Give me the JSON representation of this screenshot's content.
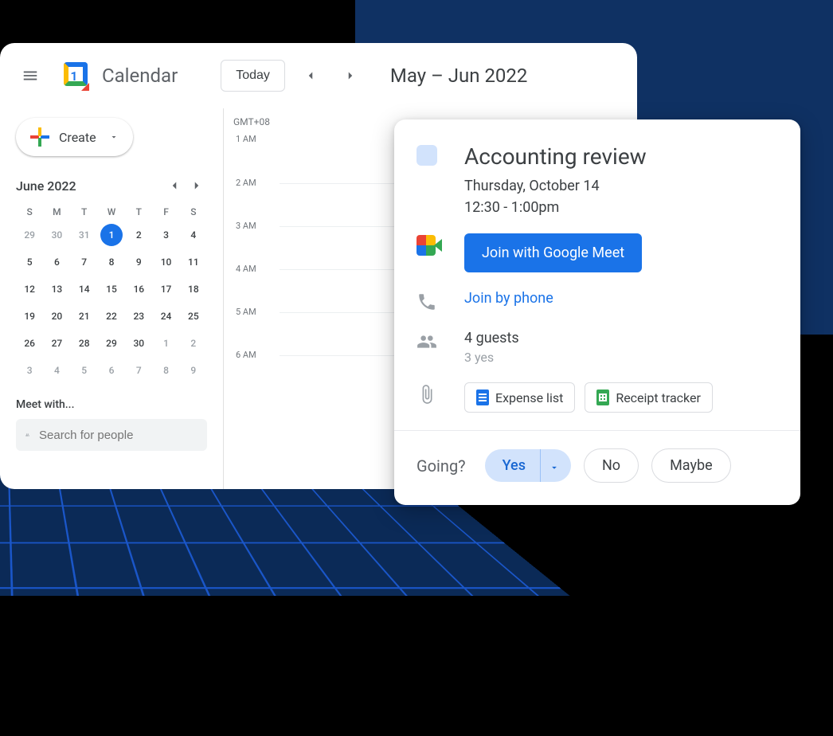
{
  "app": {
    "title": "Calendar",
    "logo_day": "1"
  },
  "header": {
    "today_label": "Today",
    "date_range": "May – Jun 2022"
  },
  "create": {
    "label": "Create"
  },
  "miniCalendar": {
    "title": "June 2022",
    "dow": [
      "S",
      "M",
      "T",
      "W",
      "T",
      "F",
      "S"
    ],
    "weeks": [
      [
        {
          "d": "29",
          "muted": true
        },
        {
          "d": "30",
          "muted": true
        },
        {
          "d": "31",
          "muted": true
        },
        {
          "d": "1",
          "selected": true
        },
        {
          "d": "2"
        },
        {
          "d": "3"
        },
        {
          "d": "4"
        }
      ],
      [
        {
          "d": "5"
        },
        {
          "d": "6"
        },
        {
          "d": "7"
        },
        {
          "d": "8"
        },
        {
          "d": "9"
        },
        {
          "d": "10"
        },
        {
          "d": "11"
        }
      ],
      [
        {
          "d": "12"
        },
        {
          "d": "13"
        },
        {
          "d": "14"
        },
        {
          "d": "15"
        },
        {
          "d": "16"
        },
        {
          "d": "17"
        },
        {
          "d": "18"
        }
      ],
      [
        {
          "d": "19"
        },
        {
          "d": "20"
        },
        {
          "d": "21"
        },
        {
          "d": "22"
        },
        {
          "d": "23"
        },
        {
          "d": "24"
        },
        {
          "d": "25"
        }
      ],
      [
        {
          "d": "26"
        },
        {
          "d": "27"
        },
        {
          "d": "28"
        },
        {
          "d": "29"
        },
        {
          "d": "30"
        },
        {
          "d": "1",
          "muted": true
        },
        {
          "d": "2",
          "muted": true
        }
      ],
      [
        {
          "d": "3",
          "muted": true
        },
        {
          "d": "4",
          "muted": true
        },
        {
          "d": "5",
          "muted": true
        },
        {
          "d": "6",
          "muted": true
        },
        {
          "d": "7",
          "muted": true
        },
        {
          "d": "8",
          "muted": true
        },
        {
          "d": "9",
          "muted": true
        }
      ]
    ]
  },
  "meetWith": {
    "label": "Meet with...",
    "placeholder": "Search for people"
  },
  "timegrid": {
    "timezone": "GMT+08",
    "hours": [
      "1 AM",
      "2 AM",
      "3 AM",
      "4 AM",
      "5 AM",
      "6 AM"
    ]
  },
  "event": {
    "title": "Accounting review",
    "date": "Thursday, October 14",
    "time": "12:30 - 1:00pm",
    "join_meet_label": "Join with Google Meet",
    "join_phone_label": "Join by phone",
    "guest_count": "4 guests",
    "guest_sub": "3 yes",
    "attachments": [
      {
        "label": "Expense list",
        "type": "doc"
      },
      {
        "label": "Receipt tracker",
        "type": "sheet"
      }
    ],
    "rsvp": {
      "prompt": "Going?",
      "yes": "Yes",
      "no": "No",
      "maybe": "Maybe"
    }
  }
}
